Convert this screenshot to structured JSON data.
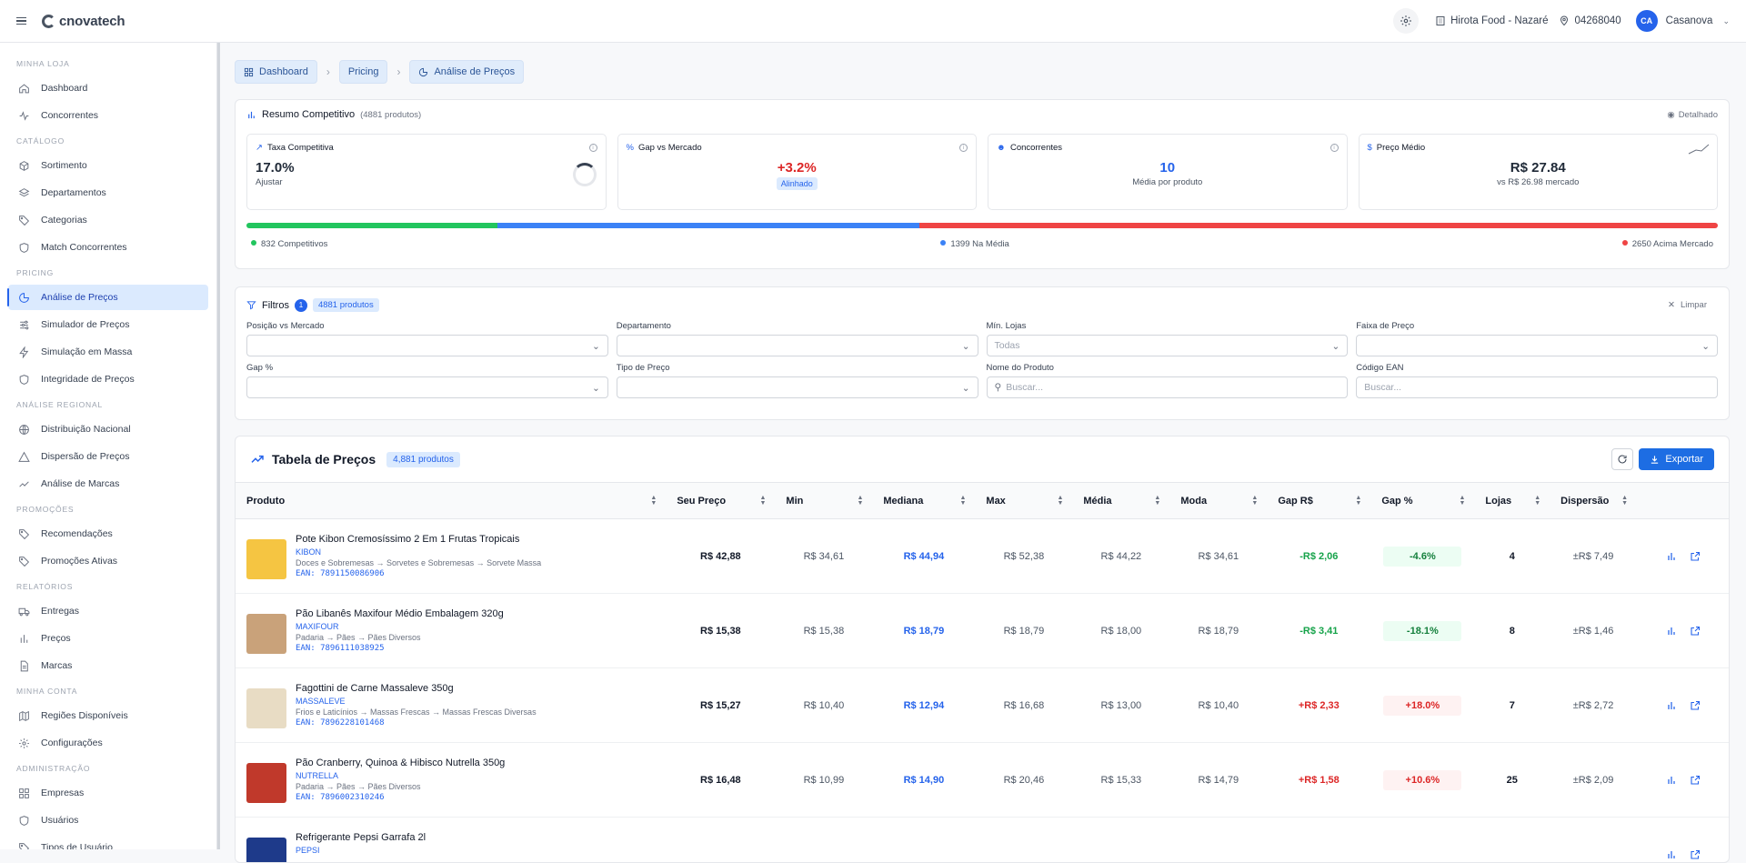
{
  "topbar": {
    "brand": "cnovatech",
    "store": "Hirota Food - Nazaré",
    "cep": "04268040",
    "avatar_initials": "CA",
    "user": "Casanova"
  },
  "sidebar": {
    "sections": [
      {
        "title": "MINHA LOJA",
        "items": [
          {
            "label": "Dashboard",
            "icon": "home-icon"
          },
          {
            "label": "Concorrentes",
            "icon": "activity-icon"
          }
        ]
      },
      {
        "title": "CATÁLOGO",
        "items": [
          {
            "label": "Sortimento",
            "icon": "box-icon"
          },
          {
            "label": "Departamentos",
            "icon": "layers-icon"
          },
          {
            "label": "Categorias",
            "icon": "tag-icon"
          },
          {
            "label": "Match Concorrentes",
            "icon": "shield-icon"
          }
        ]
      },
      {
        "title": "PRICING",
        "items": [
          {
            "label": "Análise de Preços",
            "icon": "pie-chart-icon",
            "active": true
          },
          {
            "label": "Simulador de Preços",
            "icon": "sliders-icon"
          },
          {
            "label": "Simulação em Massa",
            "icon": "zap-icon"
          },
          {
            "label": "Integridade de Preços",
            "icon": "shield-icon"
          }
        ]
      },
      {
        "title": "ANÁLISE REGIONAL",
        "items": [
          {
            "label": "Distribuição Nacional",
            "icon": "globe-icon"
          },
          {
            "label": "Dispersão de Preços",
            "icon": "triangle-icon"
          },
          {
            "label": "Análise de Marcas",
            "icon": "trending-up-icon"
          }
        ]
      },
      {
        "title": "PROMOÇÕES",
        "items": [
          {
            "label": "Recomendações",
            "icon": "tag-icon"
          },
          {
            "label": "Promoções Ativas",
            "icon": "tag-icon"
          }
        ]
      },
      {
        "title": "RELATÓRIOS",
        "items": [
          {
            "label": "Entregas",
            "icon": "truck-icon"
          },
          {
            "label": "Preços",
            "icon": "bar-chart-icon"
          },
          {
            "label": "Marcas",
            "icon": "file-icon"
          }
        ]
      },
      {
        "title": "MINHA CONTA",
        "items": [
          {
            "label": "Regiões Disponíveis",
            "icon": "map-icon"
          },
          {
            "label": "Configurações",
            "icon": "gear-icon"
          }
        ]
      },
      {
        "title": "ADMINISTRAÇÃO",
        "items": [
          {
            "label": "Empresas",
            "icon": "grid-icon"
          },
          {
            "label": "Usuários",
            "icon": "shield-icon"
          },
          {
            "label": "Tipos de Usuário",
            "icon": "tag-icon"
          }
        ]
      }
    ]
  },
  "breadcrumb": [
    "Dashboard",
    "Pricing",
    "Análise de Preços"
  ],
  "resumo": {
    "title": "Resumo Competitivo",
    "count": "(4881 produtos)",
    "detalhado": "Detalhado",
    "kpis": {
      "taxa": {
        "label": "Taxa Competitiva",
        "value": "17.0%",
        "sub": "Ajustar"
      },
      "gap": {
        "label": "Gap vs Mercado",
        "value": "+3.2%",
        "badge": "Alinhado"
      },
      "conc": {
        "label": "Concorrentes",
        "value": "10",
        "sub": "Média por produto"
      },
      "preco": {
        "label": "Preço Médio",
        "value": "R$ 27.84",
        "sub": "vs R$ 26.98 mercado"
      }
    },
    "distribution": {
      "competitivos": 832,
      "na_media": 1399,
      "acima": 2650,
      "competitivos_label": "832 Competitivos",
      "na_media_label": "1399 Na Média",
      "acima_label": "2650 Acima Mercado",
      "colors": {
        "competitivos": "#22c55e",
        "na_media": "#3b82f6",
        "acima": "#ef4444"
      }
    }
  },
  "filtros": {
    "title": "Filtros",
    "count": "1",
    "produtos": "4881 produtos",
    "limpar": "Limpar",
    "fields": [
      {
        "label": "Posição vs Mercado",
        "value": "",
        "type": "select"
      },
      {
        "label": "Departamento",
        "value": "",
        "type": "select"
      },
      {
        "label": "Mín. Lojas",
        "value": "Todas",
        "type": "select"
      },
      {
        "label": "Faixa de Preço",
        "value": "",
        "type": "select"
      },
      {
        "label": "Gap %",
        "value": "",
        "type": "select"
      },
      {
        "label": "Tipo de Preço",
        "value": "",
        "type": "select"
      },
      {
        "label": "Nome do Produto",
        "placeholder": "Buscar...",
        "type": "search"
      },
      {
        "label": "Código EAN",
        "placeholder": "Buscar...",
        "type": "text"
      }
    ]
  },
  "tabela": {
    "title": "Tabela de Preços",
    "badge": "4,881 produtos",
    "export": "Exportar",
    "columns": [
      "Produto",
      "Seu Preço",
      "Min",
      "Mediana",
      "Max",
      "Média",
      "Moda",
      "Gap R$",
      "Gap %",
      "Lojas",
      "Dispersão"
    ],
    "rows": [
      {
        "name": "Pote Kibon Cremosíssimo 2 Em 1 Frutas Tropicais",
        "brand": "KIBON",
        "category": "Doces e Sobremesas → Sorvetes e Sobremesas → Sorvete Massa",
        "ean": "EAN: 7891150086906",
        "seu": "R$ 42,88",
        "min": "R$ 34,61",
        "mediana": "R$ 44,94",
        "max": "R$ 52,38",
        "media": "R$ 44,22",
        "moda": "R$ 34,61",
        "gap_rs": "-R$ 2,06",
        "gap_pct": "-4.6%",
        "lojas": "4",
        "dispersao": "±R$ 7,49",
        "dir": "neg",
        "thumb": "#f5c542"
      },
      {
        "name": "Pão Libanês Maxifour Médio Embalagem 320g",
        "brand": "MAXIFOUR",
        "category": "Padaria → Pães → Pães Diversos",
        "ean": "EAN: 7896111038925",
        "seu": "R$ 15,38",
        "min": "R$ 15,38",
        "mediana": "R$ 18,79",
        "max": "R$ 18,79",
        "media": "R$ 18,00",
        "moda": "R$ 18,79",
        "gap_rs": "-R$ 3,41",
        "gap_pct": "-18.1%",
        "lojas": "8",
        "dispersao": "±R$ 1,46",
        "dir": "neg",
        "thumb": "#c9a27a"
      },
      {
        "name": "Fagottini de Carne Massaleve 350g",
        "brand": "MASSALEVE",
        "category": "Frios e Laticínios → Massas Frescas → Massas Frescas Diversas",
        "ean": "EAN: 7896228101468",
        "seu": "R$ 15,27",
        "min": "R$ 10,40",
        "mediana": "R$ 12,94",
        "max": "R$ 16,68",
        "media": "R$ 13,00",
        "moda": "R$ 10,40",
        "gap_rs": "+R$ 2,33",
        "gap_pct": "+18.0%",
        "lojas": "7",
        "dispersao": "±R$ 2,72",
        "dir": "pos",
        "thumb": "#e8dcc4"
      },
      {
        "name": "Pão Cranberry, Quinoa & Hibisco Nutrella 350g",
        "brand": "NUTRELLA",
        "category": "Padaria → Pães → Pães Diversos",
        "ean": "EAN: 7896002310246",
        "seu": "R$ 16,48",
        "min": "R$ 10,99",
        "mediana": "R$ 14,90",
        "max": "R$ 20,46",
        "media": "R$ 15,33",
        "moda": "R$ 14,79",
        "gap_rs": "+R$ 1,58",
        "gap_pct": "+10.6%",
        "lojas": "25",
        "dispersao": "±R$ 2,09",
        "dir": "pos",
        "thumb": "#c0392b"
      },
      {
        "name": "Refrigerante Pepsi Garrafa 2l",
        "brand": "PEPSI",
        "category": "",
        "ean": "",
        "seu": "",
        "min": "",
        "mediana": "",
        "max": "",
        "media": "",
        "moda": "",
        "gap_rs": "",
        "gap_pct": "",
        "lojas": "",
        "dispersao": "",
        "dir": "pos",
        "thumb": "#1e3a8a"
      }
    ]
  }
}
